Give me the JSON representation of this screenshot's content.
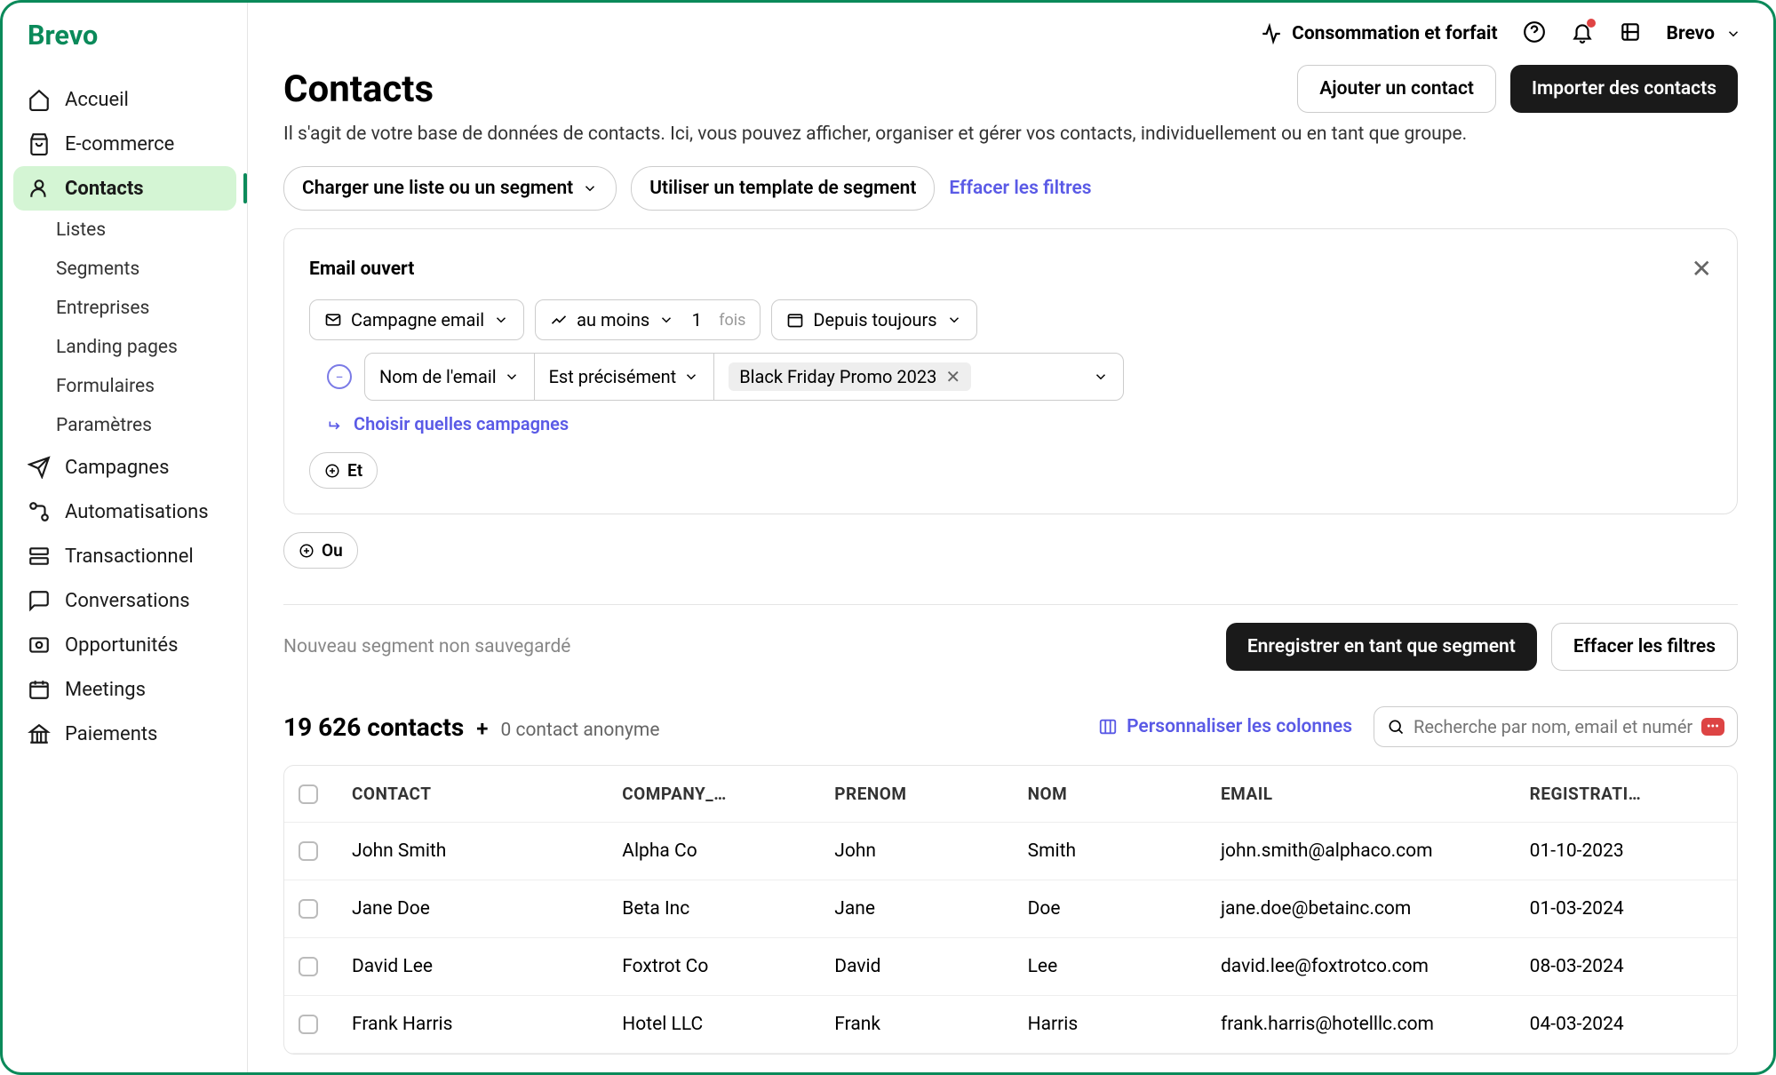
{
  "brand": "Brevo",
  "topbar": {
    "consumption": "Consommation et forfait",
    "profile_name": "Brevo"
  },
  "sidebar": {
    "items": [
      {
        "label": "Accueil",
        "icon": "home"
      },
      {
        "label": "E-commerce",
        "icon": "bag"
      },
      {
        "label": "Contacts",
        "icon": "user",
        "active": true
      },
      {
        "label": "Campagnes",
        "icon": "send"
      },
      {
        "label": "Automatisations",
        "icon": "flow"
      },
      {
        "label": "Transactionnel",
        "icon": "server"
      },
      {
        "label": "Conversations",
        "icon": "chat"
      },
      {
        "label": "Opportunités",
        "icon": "target"
      },
      {
        "label": "Meetings",
        "icon": "calendar"
      },
      {
        "label": "Paiements",
        "icon": "bank"
      }
    ],
    "sub": [
      "Listes",
      "Segments",
      "Entreprises",
      "Landing pages",
      "Formulaires",
      "Paramètres"
    ]
  },
  "page": {
    "title": "Contacts",
    "description": "Il s'agit de votre base de données de contacts. Ici, vous pouvez afficher, organiser et gérer vos contacts, individuellement ou en tant que groupe.",
    "add_contact": "Ajouter un contact",
    "import_contacts": "Importer des contacts"
  },
  "filters": {
    "load_list": "Charger une liste ou un segment",
    "use_template": "Utiliser un template de segment",
    "clear": "Effacer les filtres"
  },
  "filter_panel": {
    "title": "Email ouvert",
    "campaign_type": "Campagne email",
    "at_least": "au moins",
    "count": "1",
    "times": "fois",
    "since": "Depuis toujours",
    "field_name": "Nom de l'email",
    "operator": "Est précisément",
    "chip_value": "Black Friday Promo 2023",
    "choose_campaigns": "Choisir quelles campagnes",
    "and": "Et",
    "or": "Ou"
  },
  "save_row": {
    "unsaved": "Nouveau segment non sauvegardé",
    "save": "Enregistrer en tant que segment",
    "clear": "Effacer les filtres"
  },
  "results": {
    "count": "19 626 contacts",
    "plus": "+",
    "anonymous": "0 contact anonyme",
    "customize": "Personnaliser les colonnes",
    "search_placeholder": "Recherche par nom, email et numéro"
  },
  "table": {
    "headers": [
      "CONTACT",
      "COMPANY_…",
      "PRENOM",
      "NOM",
      "EMAIL",
      "REGISTRATI…"
    ],
    "rows": [
      {
        "contact": "John Smith",
        "company": "Alpha Co",
        "prenom": "John",
        "nom": "Smith",
        "email": "john.smith@alphaco.com",
        "reg": "01-10-2023"
      },
      {
        "contact": "Jane Doe",
        "company": "Beta Inc",
        "prenom": "Jane",
        "nom": "Doe",
        "email": "jane.doe@betainc.com",
        "reg": "01-03-2024"
      },
      {
        "contact": "David Lee",
        "company": "Foxtrot Co",
        "prenom": "David",
        "nom": "Lee",
        "email": "david.lee@foxtrotco.com",
        "reg": "08-03-2024"
      },
      {
        "contact": "Frank Harris",
        "company": "Hotel LLC",
        "prenom": "Frank",
        "nom": "Harris",
        "email": "frank.harris@hotelllc.com",
        "reg": "04-03-2024"
      }
    ]
  }
}
